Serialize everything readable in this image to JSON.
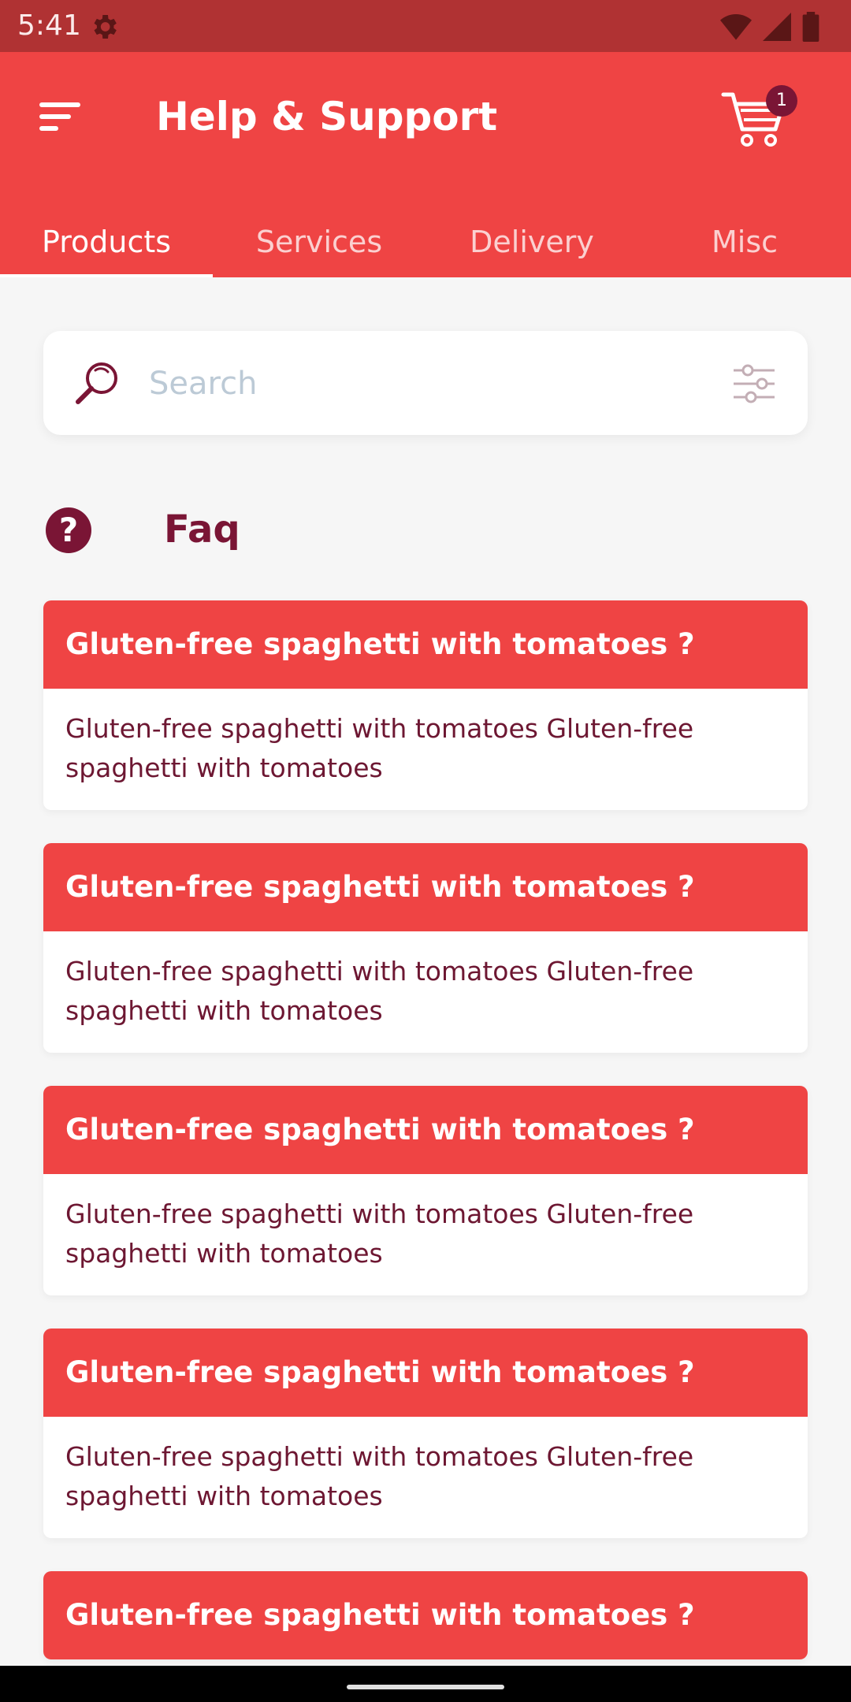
{
  "status_bar": {
    "time": "5:41",
    "icons": [
      "settings-gear-icon",
      "wifi-icon",
      "cell-signal-icon",
      "battery-icon"
    ]
  },
  "app_bar": {
    "menu_icon": "menu-icon",
    "title": "Help & Support",
    "cart_icon": "cart-icon",
    "cart_count": "1"
  },
  "tabs": [
    {
      "label": "Products",
      "active": true
    },
    {
      "label": "Services",
      "active": false
    },
    {
      "label": "Delivery",
      "active": false
    },
    {
      "label": "Misc",
      "active": false
    }
  ],
  "search": {
    "placeholder": "Search",
    "value": "",
    "search_icon": "magnifier-icon",
    "filter_icon": "filter-icon"
  },
  "faq": {
    "icon_glyph": "?",
    "title": "Faq",
    "items": [
      {
        "question": "Gluten-free spaghetti with tomatoes ?",
        "answer": "Gluten-free spaghetti with tomatoes Gluten-free spaghetti with tomatoes"
      },
      {
        "question": "Gluten-free spaghetti with tomatoes ?",
        "answer": "Gluten-free spaghetti with tomatoes Gluten-free spaghetti with tomatoes"
      },
      {
        "question": "Gluten-free spaghetti with tomatoes ?",
        "answer": "Gluten-free spaghetti with tomatoes Gluten-free spaghetti with tomatoes"
      },
      {
        "question": "Gluten-free spaghetti with tomatoes ?",
        "answer": "Gluten-free spaghetti with tomatoes Gluten-free spaghetti with tomatoes"
      },
      {
        "question": "Gluten-free spaghetti with tomatoes ?",
        "answer": ""
      }
    ]
  },
  "colors": {
    "primary": "#ef4444",
    "status_bar": "#b03233",
    "accent_dark": "#7a1535",
    "background": "#f6f6f6"
  }
}
